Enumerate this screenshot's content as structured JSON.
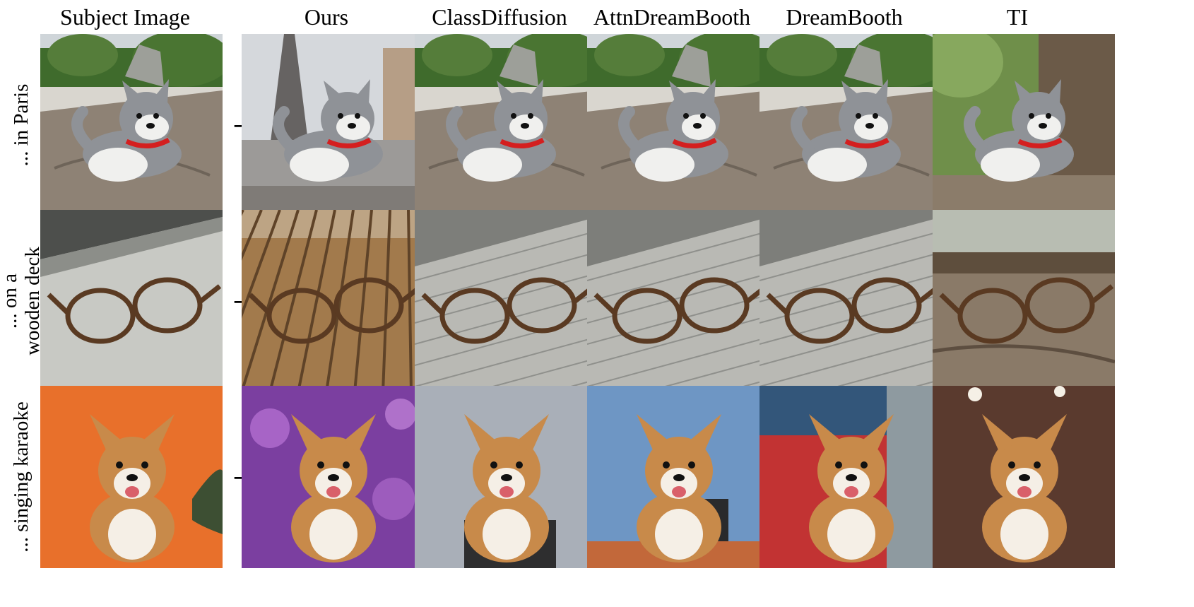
{
  "columns": [
    "Subject Image",
    "Ours",
    "ClassDiffusion",
    "AttnDreamBooth",
    "DreamBooth",
    "TI"
  ],
  "arrow": "→",
  "rows": [
    {
      "label_lines": [
        "... in Paris"
      ],
      "subject": "husky-plush",
      "cells": [
        {
          "subject": "husky-plush",
          "scene": "park-rock"
        },
        {
          "subject": "husky-plush",
          "scene": "eiffel-street"
        },
        {
          "subject": "husky-plush",
          "scene": "park-rock"
        },
        {
          "subject": "husky-plush",
          "scene": "park-rock"
        },
        {
          "subject": "husky-plush",
          "scene": "park-rock"
        },
        {
          "subject": "husky-plush",
          "scene": "tree-forest"
        }
      ]
    },
    {
      "label_lines": [
        "... on a",
        "wooden deck"
      ],
      "subject": "glasses",
      "cells": [
        {
          "subject": "glasses",
          "scene": "window-sill"
        },
        {
          "subject": "glasses",
          "scene": "wood-deck"
        },
        {
          "subject": "glasses",
          "scene": "grey-deck"
        },
        {
          "subject": "glasses",
          "scene": "grey-deck"
        },
        {
          "subject": "glasses",
          "scene": "grey-deck"
        },
        {
          "subject": "glasses",
          "scene": "old-wood"
        }
      ]
    },
    {
      "label_lines": [
        "... singing karaoke"
      ],
      "subject": "corgi",
      "cells": [
        {
          "subject": "corgi",
          "scene": "orange-studio"
        },
        {
          "subject": "corgi",
          "scene": "purple-bokeh"
        },
        {
          "subject": "corgi",
          "scene": "grey-studio"
        },
        {
          "subject": "corgi",
          "scene": "blue-studio"
        },
        {
          "subject": "corgi",
          "scene": "red-room"
        },
        {
          "subject": "corgi",
          "scene": "stage-brown"
        }
      ]
    }
  ],
  "colors": {
    "grass": "#3f6b2c",
    "rock": "#8e8275",
    "plush_grey": "#8f9297",
    "plush_white": "#f0f0ee",
    "scarf_red": "#d41f1f",
    "wood_brown": "#a27a4c",
    "deck_grey": "#b9b9b4",
    "frame_tortoise": "#5a3a22",
    "orange_bg": "#e8702b",
    "purple_bg": "#7b3fa0",
    "grey_studio": "#a9afb8",
    "blue_studio": "#6e96c4",
    "fur_tan": "#c88a4a",
    "fur_golden": "#c68c3a"
  }
}
